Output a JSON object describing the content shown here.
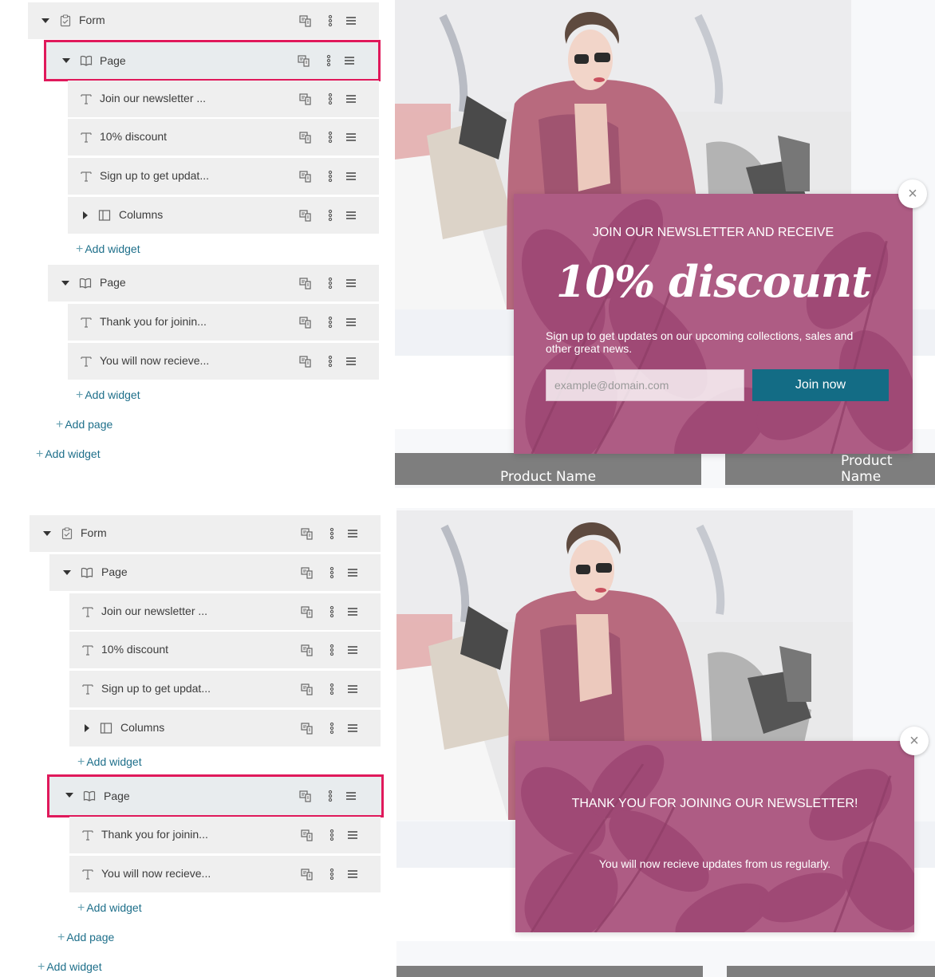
{
  "panel1": {
    "tree": {
      "form_label": "Form",
      "page1_label": "Page",
      "page1_items": [
        "Join our newsletter ...",
        "10% discount",
        "Sign up to get updat...",
        "Columns"
      ],
      "add_widget_1": "Add widget",
      "page2_label": "Page",
      "page2_items": [
        "Thank you for joinin...",
        "You will now recieve..."
      ],
      "add_widget_2": "Add widget",
      "add_page": "Add page",
      "add_widget_3": "Add widget"
    },
    "popup": {
      "heading": "JOIN OUR NEWSLETTER AND RECEIVE",
      "discount": "10% discount",
      "body": "Sign up to get updates on our upcoming collections, sales and other great news.",
      "email_placeholder": "example@domain.com",
      "join_button": "Join now",
      "close": "×"
    },
    "products": [
      "Product Name",
      "Product Name"
    ]
  },
  "panel2": {
    "tree": {
      "form_label": "Form",
      "page1_label": "Page",
      "page1_items": [
        "Join our newsletter ...",
        "10% discount",
        "Sign up to get updat...",
        "Columns"
      ],
      "add_widget_1": "Add widget",
      "page2_label": "Page",
      "page2_items": [
        "Thank you for joinin...",
        "You will now recieve..."
      ],
      "add_widget_2": "Add widget",
      "add_page": "Add page",
      "add_widget_3": "Add widget"
    },
    "popup": {
      "heading": "THANK YOU FOR JOINING OUR NEWSLETTER!",
      "body": "You will now recieve updates from us regularly.",
      "close": "×"
    }
  },
  "colors": {
    "popup_bg": "#ae5c84",
    "join_button": "#136c85",
    "selection_border": "#e0195b",
    "link": "#1e6f8a"
  },
  "icons": {
    "form": "form-check-icon",
    "page": "open-book-icon",
    "text": "text-t-icon",
    "columns": "columns-icon",
    "visibility": "responsive-visibility-icon",
    "more": "kebab-menu-icon",
    "drag": "drag-handle-icon"
  }
}
